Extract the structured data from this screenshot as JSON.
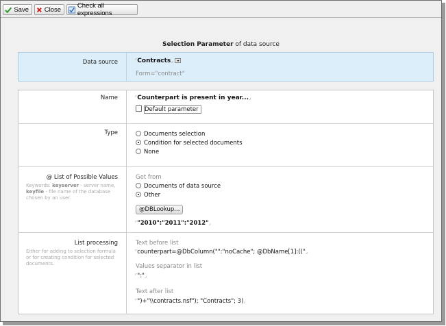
{
  "toolbar": {
    "save_label": "Save",
    "close_label": "Close",
    "check_label": "Check all expressions"
  },
  "title": {
    "bold": "Selection Parameter",
    "rest": " of data source"
  },
  "data_source": {
    "label": "Data source",
    "value": "Contracts",
    "form": "Form=\"contract\""
  },
  "name": {
    "label": "Name",
    "value": "Counterpart is present in year...",
    "default_label": "Default parameter",
    "default_checked": false
  },
  "type": {
    "label": "Type",
    "options": [
      "Documents selection",
      "Condition for selected documents",
      "None"
    ],
    "selected": "Condition for selected documents"
  },
  "possible_values": {
    "label": "@ List of Possible Values",
    "hint": {
      "p1": "Keywords: ",
      "k1": "keyserver",
      "p2": " - server name,",
      "k2": "keyfile",
      "p3": " - file name of the database chosen by an user."
    },
    "get_from_label": "Get from",
    "options": [
      "Documents of data source",
      "Other"
    ],
    "selected": "Other",
    "lookup_button": "@DBLookup...",
    "value": "\"2010\":\"2011\":\"2012\""
  },
  "list_processing": {
    "label": "List processing",
    "hint": "Either for adding to selection formula or for creating condition for selected documents.",
    "before_label": "Text before list",
    "before_value": "counterpart=@DbColumn(\"\":\"noCache\"; @DbName[1]:((\"",
    "separator_label": "Values separator in list",
    "separator_value": "\":\"",
    "after_label": "Text after list",
    "after_value": "\")+\"\\\\contracts.nsf\"); \"Contracts\"; 3)"
  },
  "colors": {
    "ds_background": "#dceefa",
    "save_icon": "#2e9a2e",
    "close_icon": "#cc1f1f"
  }
}
